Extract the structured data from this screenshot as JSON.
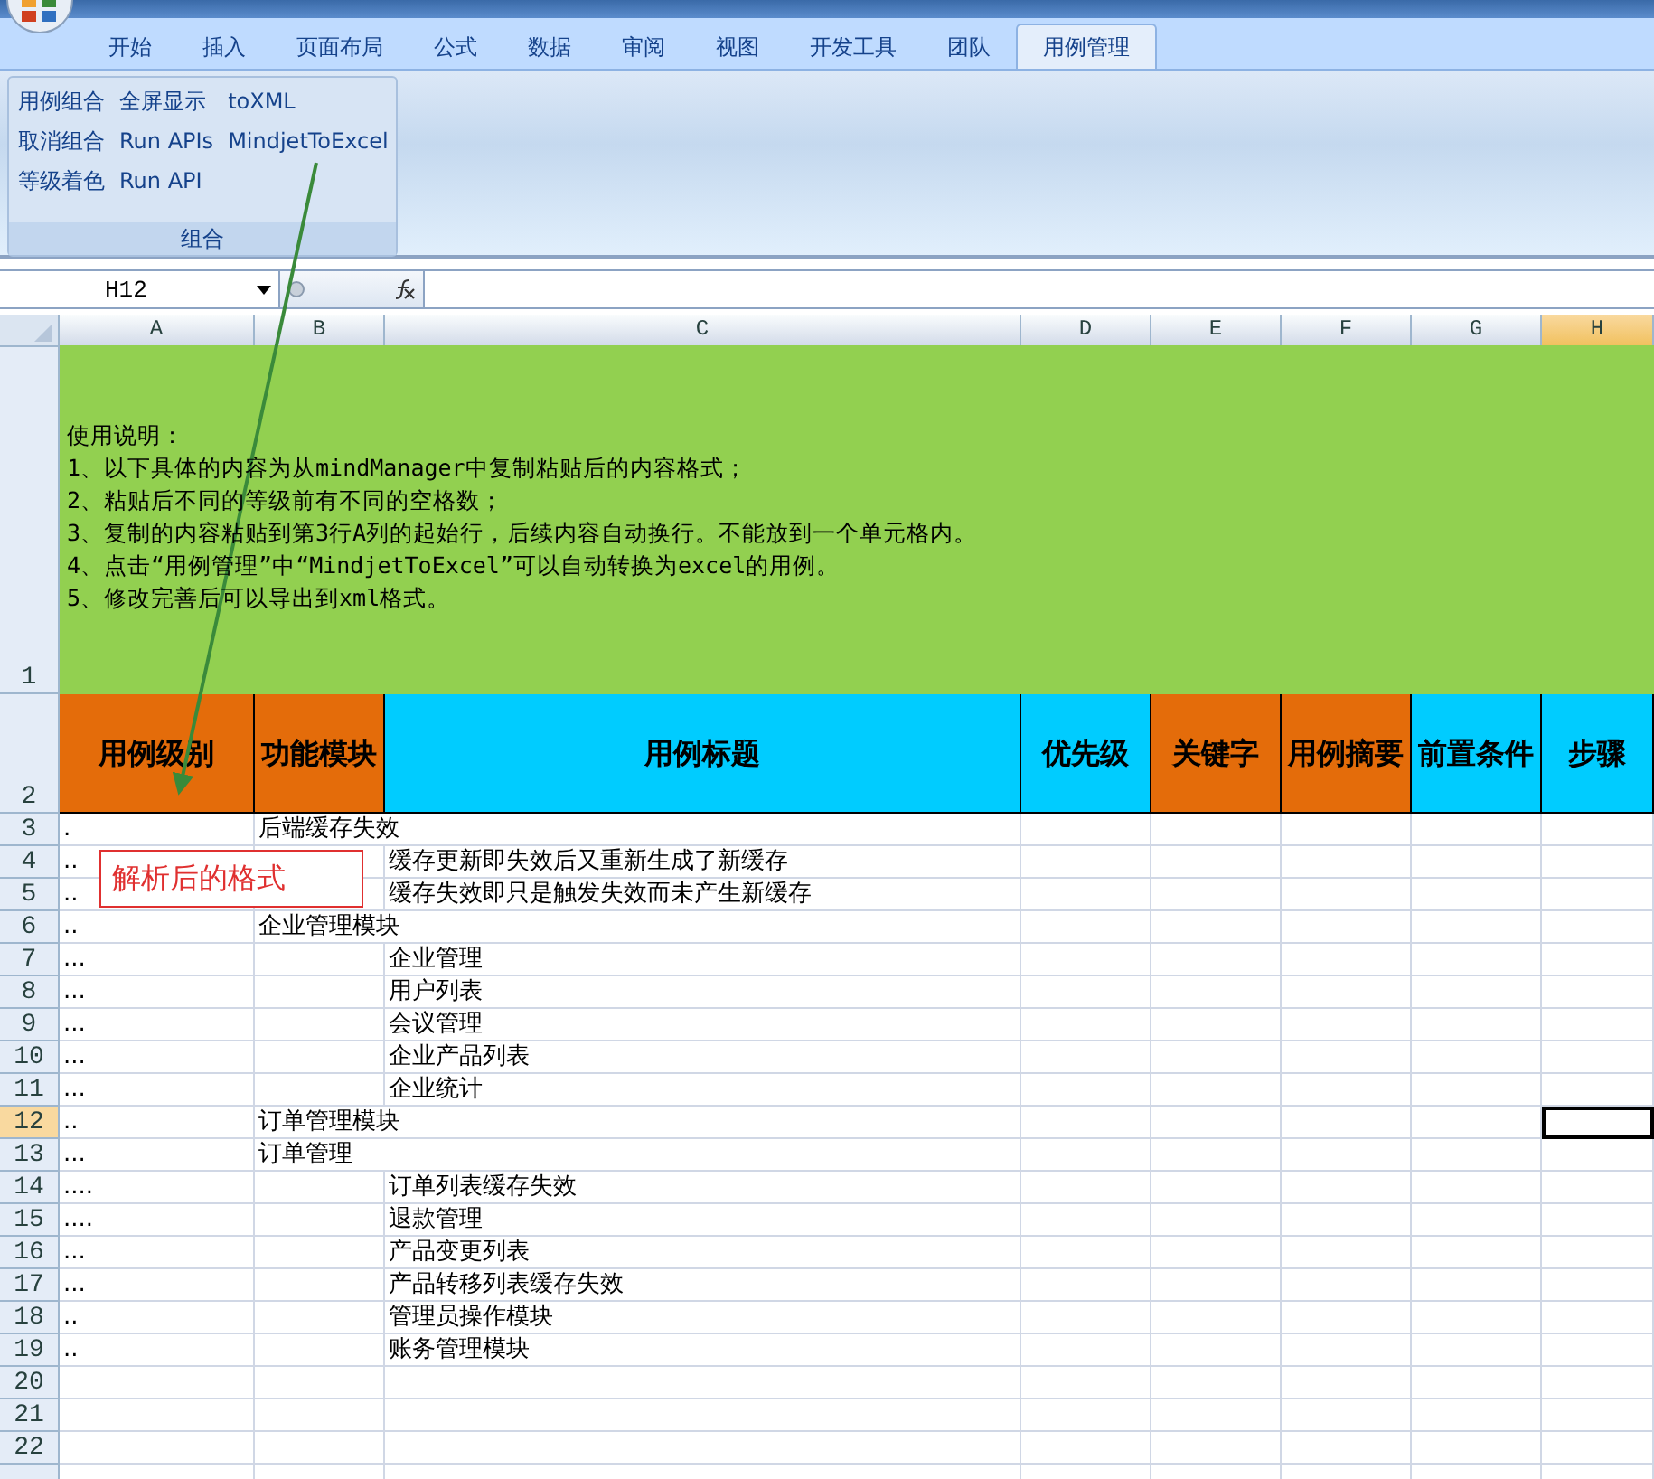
{
  "tabs": [
    {
      "label": "开始",
      "selected": false
    },
    {
      "label": "插入",
      "selected": false
    },
    {
      "label": "页面布局",
      "selected": false
    },
    {
      "label": "公式",
      "selected": false
    },
    {
      "label": "数据",
      "selected": false
    },
    {
      "label": "审阅",
      "selected": false
    },
    {
      "label": "视图",
      "selected": false
    },
    {
      "label": "开发工具",
      "selected": false
    },
    {
      "label": "团队",
      "selected": false
    },
    {
      "label": "用例管理",
      "selected": true
    }
  ],
  "ribbon": {
    "group_label": "组合",
    "buttons": [
      "用例组合",
      "取消组合",
      "等级着色",
      "全屏显示",
      "Run APIs",
      "Run API",
      "toXML",
      "MindjetToExcel"
    ]
  },
  "name_box": "H12",
  "columns": [
    {
      "label": "A",
      "selected": false
    },
    {
      "label": "B",
      "selected": false
    },
    {
      "label": "C",
      "selected": false
    },
    {
      "label": "D",
      "selected": false
    },
    {
      "label": "E",
      "selected": false
    },
    {
      "label": "F",
      "selected": false
    },
    {
      "label": "G",
      "selected": false
    },
    {
      "label": "H",
      "selected": true
    }
  ],
  "instructions": {
    "row": "1",
    "lines": [
      "使用说明：",
      "1、以下具体的内容为从mindManager中复制粘贴后的内容格式；",
      "2、粘贴后不同的等级前有不同的空格数；",
      "3、复制的内容粘贴到第3行A列的起始行，后续内容自动换行。不能放到一个单元格内。",
      "4、点击“用例管理”中“MindjetToExcel”可以自动转换为excel的用例。",
      "5、修改完善后可以导出到xml格式。"
    ]
  },
  "header_row": {
    "row": "2",
    "cells": [
      {
        "label": "用例级别",
        "color": "#e46c0a"
      },
      {
        "label": "功能模块",
        "color": "#e46c0a"
      },
      {
        "label": "用例标题",
        "color": "#00ccff"
      },
      {
        "label": "优先级",
        "color": "#00ccff"
      },
      {
        "label": "关键字",
        "color": "#e46c0a"
      },
      {
        "label": "用例摘要",
        "color": "#e46c0a"
      },
      {
        "label": "前置条件",
        "color": "#00ccff"
      },
      {
        "label": "步骤",
        "color": "#00ccff"
      }
    ]
  },
  "rows": [
    {
      "number": "3",
      "selected": false,
      "level": ".",
      "module": "后端缓存失效"
    },
    {
      "number": "4",
      "selected": false,
      "level": "..",
      "title": "缓存更新即失效后又重新生成了新缓存"
    },
    {
      "number": "5",
      "selected": false,
      "level": "..",
      "title": "缓存失效即只是触发失效而未产生新缓存"
    },
    {
      "number": "6",
      "selected": false,
      "level": "..",
      "module": "企业管理模块"
    },
    {
      "number": "7",
      "selected": false,
      "level": "...",
      "title": "企业管理"
    },
    {
      "number": "8",
      "selected": false,
      "level": "...",
      "title": "用户列表"
    },
    {
      "number": "9",
      "selected": false,
      "level": "...",
      "title": "会议管理"
    },
    {
      "number": "10",
      "selected": false,
      "level": "...",
      "title": "企业产品列表"
    },
    {
      "number": "11",
      "selected": false,
      "level": "...",
      "title": "企业统计"
    },
    {
      "number": "12",
      "selected": true,
      "level": "..",
      "module": "订单管理模块"
    },
    {
      "number": "13",
      "selected": false,
      "level": "...",
      "module": "订单管理"
    },
    {
      "number": "14",
      "selected": false,
      "level": "....",
      "title": "订单列表缓存失效"
    },
    {
      "number": "15",
      "selected": false,
      "level": "....",
      "title": "退款管理"
    },
    {
      "number": "16",
      "selected": false,
      "level": "...",
      "title": "产品变更列表"
    },
    {
      "number": "17",
      "selected": false,
      "level": "...",
      "title": "产品转移列表缓存失效"
    },
    {
      "number": "18",
      "selected": false,
      "level": "..",
      "title": "管理员操作模块"
    },
    {
      "number": "19",
      "selected": false,
      "level": "..",
      "title": "账务管理模块"
    },
    {
      "number": "20",
      "selected": false
    },
    {
      "number": "21",
      "selected": false
    },
    {
      "number": "22",
      "selected": false
    },
    {
      "selected": false
    }
  ],
  "callout": "解析后的格式"
}
